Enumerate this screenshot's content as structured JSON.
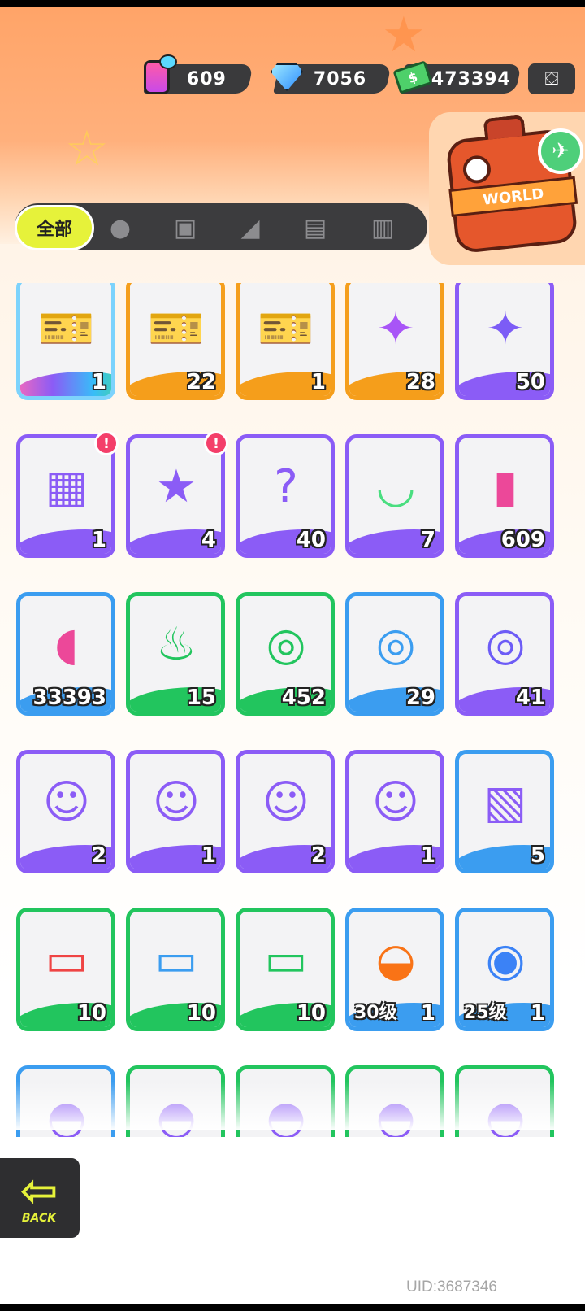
{
  "currencies": [
    {
      "name": "spray",
      "icon": "spray-can-icon",
      "value": "609"
    },
    {
      "name": "gem",
      "icon": "diamond-icon",
      "value": "7056"
    },
    {
      "name": "cash",
      "icon": "cash-icon",
      "value": "473394"
    }
  ],
  "world": {
    "label": "WORLD"
  },
  "tabs": {
    "all_label": "全部",
    "icons": [
      "person-icon",
      "box-icon",
      "spray-gun-icon",
      "card-icon",
      "book-icon"
    ]
  },
  "items": [
    {
      "qty": "1",
      "border": "rainbow",
      "icon": "crown-ticket-icon"
    },
    {
      "qty": "22",
      "border": "orange",
      "icon": "gold-ticket-icon"
    },
    {
      "qty": "1",
      "border": "orange",
      "icon": "purple-ticket-icon"
    },
    {
      "qty": "28",
      "border": "orange",
      "icon": "rainbow-star-icon"
    },
    {
      "qty": "50",
      "border": "purple",
      "icon": "purple-star-icon"
    },
    {
      "qty": "1",
      "border": "purple",
      "icon": "splash-box-icon",
      "badge": "!"
    },
    {
      "qty": "4",
      "border": "purple",
      "icon": "travel-card-icon",
      "badge": "!"
    },
    {
      "qty": "40",
      "border": "purple",
      "icon": "mystery-deity-icon"
    },
    {
      "qty": "7",
      "border": "purple",
      "icon": "open-cup-icon"
    },
    {
      "qty": "609",
      "border": "purple",
      "icon": "spray-can-icon"
    },
    {
      "qty": "33393",
      "border": "blue",
      "icon": "paint-tube-icon"
    },
    {
      "qty": "15",
      "border": "green",
      "icon": "green-flame-icon"
    },
    {
      "qty": "452",
      "border": "green",
      "icon": "green-tape-icon"
    },
    {
      "qty": "29",
      "border": "blue",
      "icon": "blue-tape-icon"
    },
    {
      "qty": "41",
      "border": "purple",
      "icon": "purple-tape-icon"
    },
    {
      "qty": "2",
      "border": "purple",
      "icon": "deity-portrait-icon"
    },
    {
      "qty": "1",
      "border": "purple",
      "icon": "deity-portrait-icon"
    },
    {
      "qty": "2",
      "border": "purple",
      "icon": "deity-portrait-icon"
    },
    {
      "qty": "1",
      "border": "purple",
      "icon": "deity-portrait-icon"
    },
    {
      "qty": "5",
      "border": "blue",
      "icon": "sticker-pack-icon"
    },
    {
      "qty": "10",
      "border": "green",
      "icon": "red-pass-icon"
    },
    {
      "qty": "10",
      "border": "green",
      "icon": "blue-pass-icon"
    },
    {
      "qty": "10",
      "border": "green",
      "icon": "green-pass-icon"
    },
    {
      "qty": "1",
      "border": "blue",
      "icon": "sunglasses-icon",
      "level": "30级"
    },
    {
      "qty": "1",
      "border": "blue",
      "icon": "blaster-icon",
      "level": "25级"
    },
    {
      "qty": "",
      "border": "blue",
      "icon": "partial-item-icon"
    },
    {
      "qty": "",
      "border": "green",
      "icon": "partial-item-icon"
    },
    {
      "qty": "",
      "border": "green",
      "icon": "partial-item-icon"
    },
    {
      "qty": "",
      "border": "green",
      "icon": "partial-item-icon"
    },
    {
      "qty": "",
      "border": "green",
      "icon": "partial-item-icon"
    }
  ],
  "back": {
    "label": "BACK"
  },
  "uid": "UID:3687346"
}
